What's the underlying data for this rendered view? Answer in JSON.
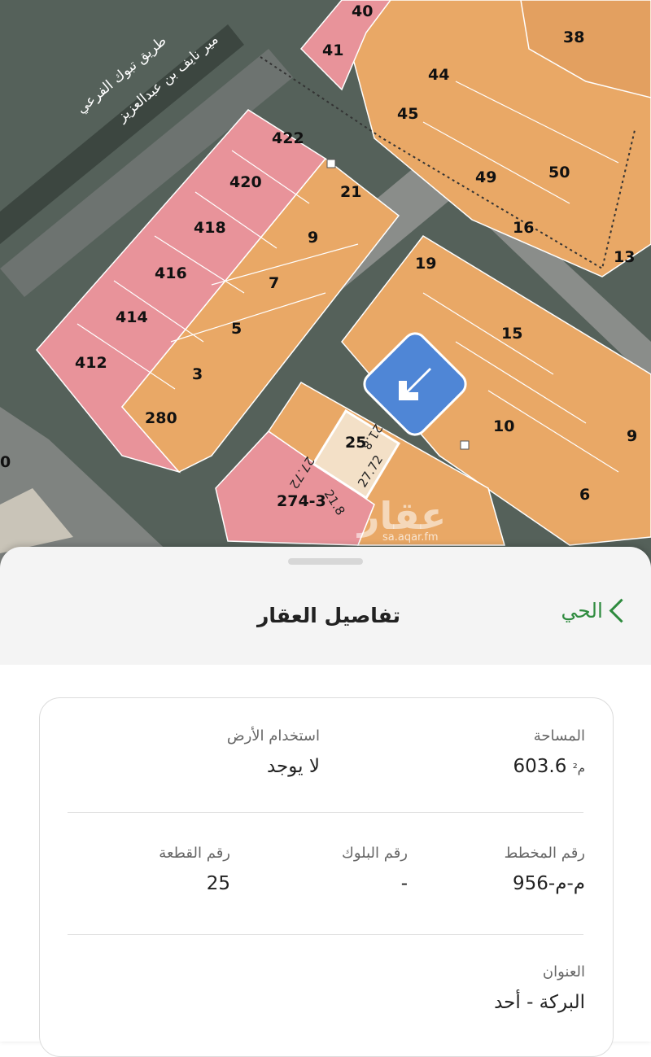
{
  "map": {
    "plots_pink": [
      {
        "label": "40"
      },
      {
        "label": "41"
      },
      {
        "label": "422"
      },
      {
        "label": "420"
      },
      {
        "label": "418"
      },
      {
        "label": "416"
      },
      {
        "label": "414"
      },
      {
        "label": "412"
      },
      {
        "label": "280"
      },
      {
        "label": "274-3"
      }
    ],
    "plots_orange": [
      {
        "label": "38"
      },
      {
        "label": "44"
      },
      {
        "label": "45"
      },
      {
        "label": "49"
      },
      {
        "label": "50"
      },
      {
        "label": "16"
      },
      {
        "label": "13"
      },
      {
        "label": "21"
      },
      {
        "label": "9"
      },
      {
        "label": "7"
      },
      {
        "label": "5"
      },
      {
        "label": "3"
      },
      {
        "label": "19"
      },
      {
        "label": "15"
      },
      {
        "label": "10"
      },
      {
        "label": "9"
      },
      {
        "label": "6"
      },
      {
        "label": "25"
      },
      {
        "label": "0"
      }
    ],
    "road_name_1": "طريق تبوك الفرعي",
    "road_name_2": "مير نايف بن عبدالعزيز",
    "dimensions": {
      "top": "21.8",
      "left": "27.72",
      "right": "27.72",
      "bottom": "21.8"
    },
    "watermark": "عقار",
    "watermark_url": "sa.aqar.fm",
    "colors": {
      "pink": "#e8939a",
      "orange": "#e9a866",
      "road": "#7b7f7e",
      "selected": "#f5e4cf"
    }
  },
  "sheet": {
    "title": "تفاصيل العقار",
    "back_label": "الحي",
    "area_label": "المساحة",
    "area_value": "603.6",
    "area_unit": "م²",
    "land_use_label": "استخدام الأرض",
    "land_use_value": "لا يوجد",
    "plan_label": "رقم المخطط",
    "plan_value": "956-م-م",
    "block_label": "رقم البلوك",
    "block_value": "-",
    "parcel_label": "رقم القطعة",
    "parcel_value": "25",
    "address_label": "العنوان",
    "address_value": "البركة - أحد"
  },
  "icons": {
    "locate": "arrow-down-left-icon",
    "back": "chevron-left-icon"
  },
  "accent_color": "#2e8b3e"
}
